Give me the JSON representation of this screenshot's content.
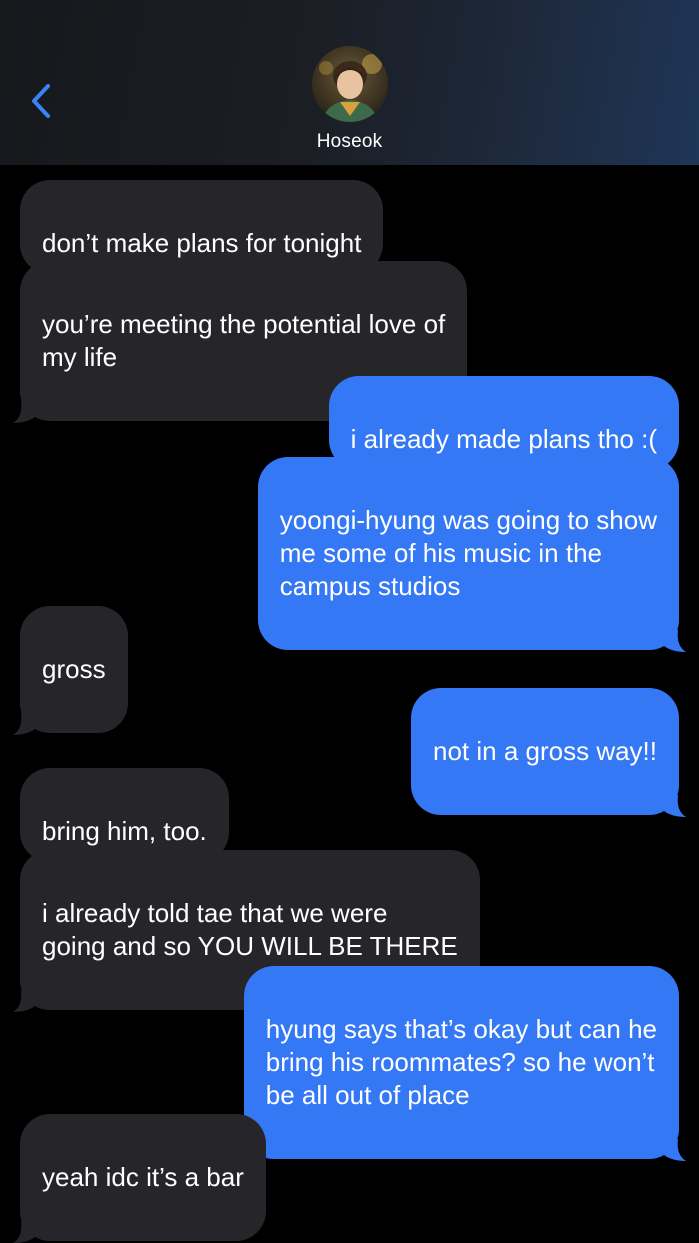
{
  "header": {
    "contact_name": "Hoseok",
    "back_icon": "chevron-left-icon",
    "avatar_icon": "contact-avatar"
  },
  "colors": {
    "incoming_bubble": "#26262a",
    "outgoing_bubble": "#3478f6",
    "back_chevron": "#3a82f7",
    "background": "#000000"
  },
  "messages": [
    {
      "sender": "them",
      "text": "don’t make plans for tonight"
    },
    {
      "sender": "them",
      "text": "you’re meeting the potential love of\nmy life"
    },
    {
      "sender": "me",
      "text": "i already made plans tho :("
    },
    {
      "sender": "me",
      "text": "yoongi-hyung was going to show\nme some of his music in the\ncampus studios"
    },
    {
      "sender": "them",
      "text": "gross"
    },
    {
      "sender": "me",
      "text": "not in a gross way!!"
    },
    {
      "sender": "them",
      "text": "bring him, too."
    },
    {
      "sender": "them",
      "text": "i already told tae that we were\ngoing and so YOU WILL BE THERE"
    },
    {
      "sender": "me",
      "text": "hyung says that’s okay but can he\nbring his roommates? so he won’t\nbe all out of place"
    },
    {
      "sender": "them",
      "text": "yeah idc it’s a bar"
    }
  ]
}
